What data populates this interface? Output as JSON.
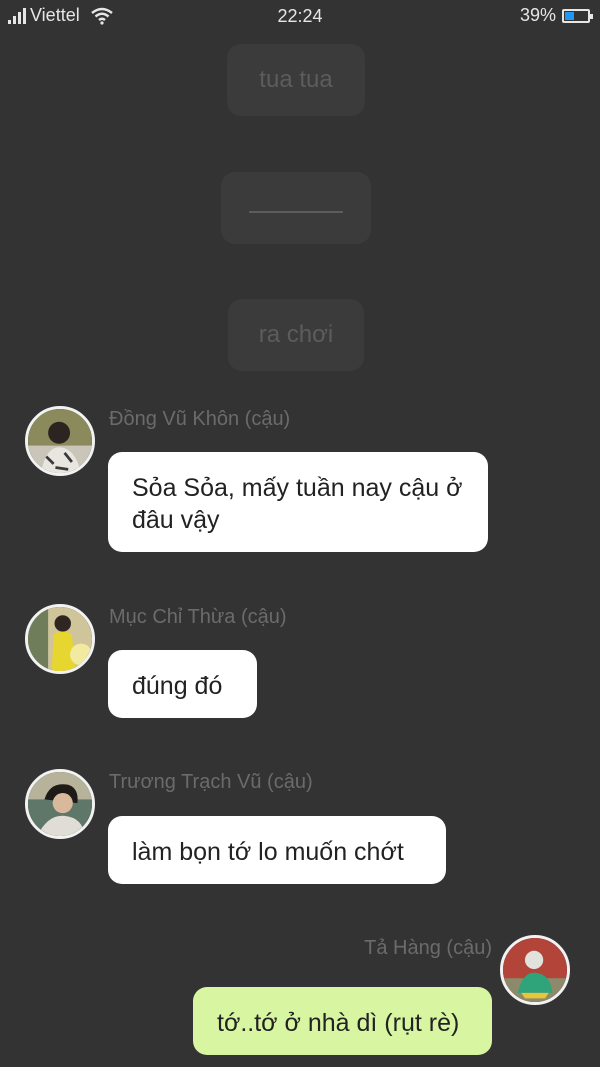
{
  "status_bar": {
    "carrier": "Viettel",
    "time": "22:24",
    "battery_percent": "39%",
    "battery_level": 0.39,
    "icons": [
      "signal-icon",
      "wifi-icon",
      "battery-icon"
    ]
  },
  "notices": [
    {
      "text": "tua tua"
    },
    {
      "text": ""
    },
    {
      "text": "ra chơi"
    }
  ],
  "messages": [
    {
      "sender": "Đồng Vũ Khôn (cậu)",
      "text": "Sỏa Sỏa, mấy tuần nay cậu ở đâu vậy"
    },
    {
      "sender": "Mục Chỉ Thừa (cậu)",
      "text": "đúng đó"
    },
    {
      "sender": "Trương Trạch Vũ (cậu)",
      "text": "làm bọn tớ lo muốn chớt"
    },
    {
      "sender": "Tả Hàng (cậu)",
      "text": "tớ..tớ ở nhà dì (rụt rè)"
    }
  ],
  "colors": {
    "background": "#333333",
    "notice_bg": "#3b3b3b",
    "bubble_incoming": "#ffffff",
    "bubble_outgoing": "#d8f5a2",
    "battery_fill": "#2196f3"
  }
}
